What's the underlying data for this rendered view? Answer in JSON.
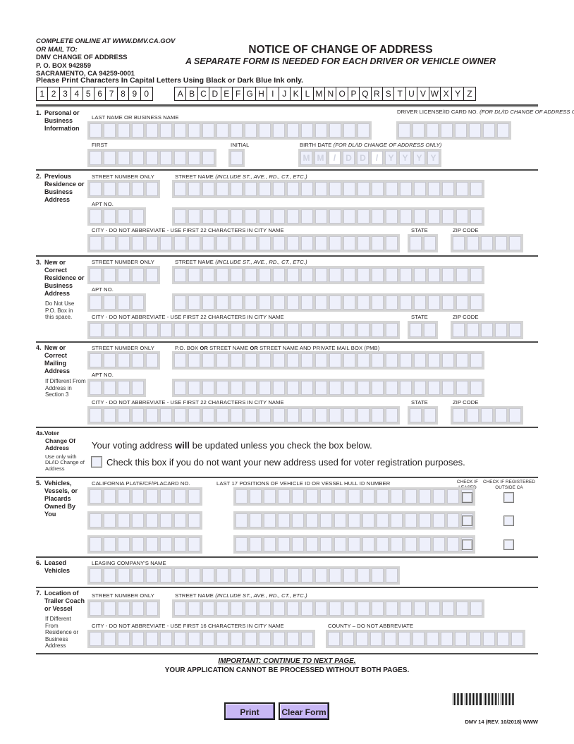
{
  "header": {
    "online_line": "COMPLETE ONLINE AT WWW.DMV.CA.GOV",
    "mail_line": "OR MAIL TO:",
    "address_lines": [
      "DMV CHANGE OF ADDRESS",
      "P. O. BOX 942859",
      "SACRAMENTO, CA 94259-0001"
    ],
    "title": "NOTICE OF CHANGE OF ADDRESS",
    "subtitle": "A SEPARATE FORM IS NEEDED FOR EACH DRIVER OR VEHICLE OWNER",
    "print_instruction": "Please Print Characters In Capital Letters Using Black or Dark Blue Ink only.",
    "sample_digits": [
      "1",
      "2",
      "3",
      "4",
      "5",
      "6",
      "7",
      "8",
      "9",
      "0"
    ],
    "sample_letters": [
      "A",
      "B",
      "C",
      "D",
      "E",
      "F",
      "G",
      "H",
      "I",
      "J",
      "K",
      "L",
      "M",
      "N",
      "O",
      "P",
      "Q",
      "R",
      "S",
      "T",
      "U",
      "V",
      "W",
      "X",
      "Y",
      "Z"
    ]
  },
  "section1": {
    "number": "1.",
    "title": "Personal or Business Information",
    "last_name_label": "LAST NAME OR BUSINESS NAME",
    "dl_label": "DRIVER LICENSE/ID CARD NO.",
    "dl_label_note": "(FOR DL/ID CHANGE OF ADDRESS ONLY)",
    "first_label": "FIRST",
    "initial_label": "INITIAL",
    "birth_label": "BIRTH DATE",
    "birth_label_note": "(FOR DL/ID CHANGE OF ADDRESS ONLY)",
    "birth_placeholders": [
      "M",
      "M",
      "/",
      "D",
      "D",
      "/",
      "Y",
      "Y",
      "Y",
      "Y"
    ]
  },
  "section2": {
    "number": "2.",
    "title": "Previous Residence or Business Address",
    "street_number_label": "STREET NUMBER ONLY",
    "street_name_label": "STREET NAME",
    "street_name_note": "(INCLUDE ST., AVE., RD., CT., ETC.)",
    "apt_label": "APT NO.",
    "city_label": "CITY - DO NOT ABBREVIATE - USE FIRST 22 CHARACTERS IN CITY NAME",
    "state_label": "STATE",
    "zip_label": "ZIP CODE"
  },
  "section3": {
    "number": "3.",
    "title": "New or Correct Residence or Business Address",
    "note": "Do Not Use P.O. Box in this space.",
    "street_number_label": "STREET NUMBER ONLY",
    "street_name_label": "STREET NAME",
    "street_name_note": "(INCLUDE ST., AVE., RD., CT., ETC.)",
    "apt_label": "APT NO.",
    "city_label": "CITY - DO NOT ABBREVIATE - USE FIRST 22 CHARACTERS IN CITY NAME",
    "state_label": "STATE",
    "zip_label": "ZIP CODE"
  },
  "section4": {
    "number": "4.",
    "title": "New or Correct Mailing Address",
    "note": "If Different From Address in Section 3",
    "street_number_label": "STREET NUMBER ONLY",
    "street_name_label_parts": [
      "P.O. BOX ",
      "OR",
      " STREET NAME ",
      "OR",
      " STREET NAME AND PRIVATE MAIL BOX (PMB)"
    ],
    "apt_label": "APT NO.",
    "city_label": "CITY - DO NOT ABBREVIATE - USE FIRST 22 CHARACTERS IN CITY NAME",
    "state_label": "STATE",
    "zip_label": "ZIP CODE"
  },
  "section4a": {
    "number": "4a.",
    "title_first": "Voter",
    "title_rest": "Change Of Address",
    "note": "Use only with DL/ID Change of Address",
    "statement_pre": "Your voting address ",
    "statement_bold": "will",
    "statement_post": " be updated unless you check the box below.",
    "checkbox_label": "Check this box if you do not want your new address used for voter registration purposes.",
    "checkbox_checked": false
  },
  "section5": {
    "number": "5.",
    "title": "Vehicles, Vessels, or Placards Owned By You",
    "plate_label": "CALIFORNIA PLATE/CF/PLACARD NO.",
    "vin_label": "LAST 17 POSITIONS OF VEHICLE ID OR VESSEL HULL ID NUMBER",
    "leased_label": "CHECK IF LEASED",
    "outside_label": "CHECK IF REGISTERED OUTSIDE CA",
    "rows": [
      {
        "leased": false,
        "outside_ca": false
      },
      {
        "leased": false,
        "outside_ca": false
      },
      {
        "leased": false,
        "outside_ca": false
      }
    ]
  },
  "section6": {
    "number": "6.",
    "title": "Leased Vehicles",
    "leasing_label": "LEASING COMPANY'S NAME"
  },
  "section7": {
    "number": "7.",
    "title": "Location of Trailer Coach or Vessel",
    "note": "If Different From Residence or Business Address",
    "street_number_label": "STREET NUMBER ONLY",
    "street_name_label": "STREET NAME",
    "street_name_note": "(INCLUDE ST., AVE., RD., CT., ETC.)",
    "city_label": "CITY - DO NOT ABBREVIATE - USE FIRST 16 CHARACTERS IN CITY NAME",
    "county_label": "COUNTY – DO NOT ABBREVIATE"
  },
  "footer": {
    "important": "IMPORTANT:  CONTINUE TO NEXT PAGE.",
    "cannot_process": "YOUR APPLICATION CANNOT BE PROCESSED WITHOUT BOTH PAGES.",
    "print_button": "Print",
    "clear_button": "Clear Form",
    "form_number": "DMV 14 (REV. 10/2018) WWW"
  },
  "colors": {
    "box_fill": "#eef0fb",
    "box_frame": "#d4d4d4",
    "button_fill": "#c9b8f5",
    "rule": "#4d4d4d"
  }
}
